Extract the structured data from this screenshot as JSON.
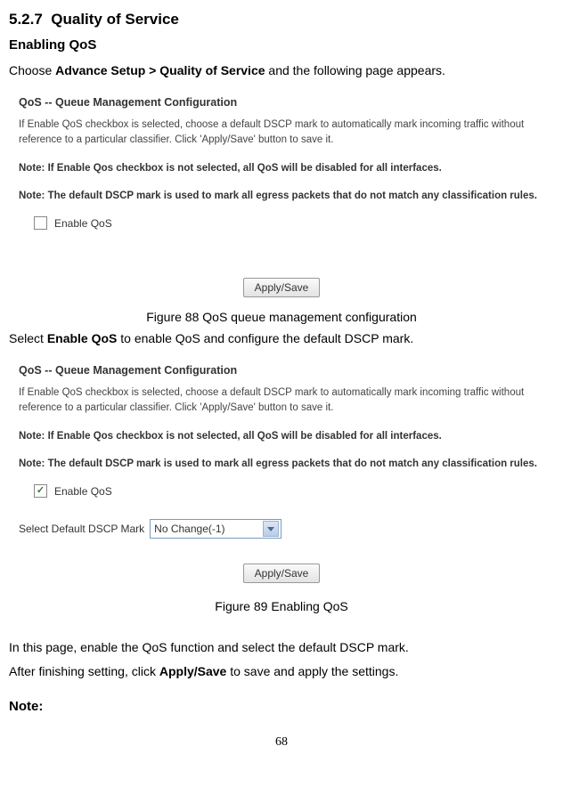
{
  "section": {
    "number": "5.2.7",
    "title": "Quality of Service"
  },
  "sub1": {
    "heading": "Enabling QoS",
    "intro_prefix": "Choose ",
    "intro_bold": "Advance Setup > Quality of Service",
    "intro_suffix": " and the following page appears."
  },
  "panel1": {
    "title": "QoS -- Queue Management Configuration",
    "desc": "If Enable QoS checkbox is selected, choose a default DSCP mark to automatically mark incoming traffic without reference to a particular classifier. Click 'Apply/Save' button to save it.",
    "note1": "Note: If Enable Qos checkbox is not selected, all QoS will be disabled for all interfaces.",
    "note2": "Note: The default DSCP mark is used to mark all egress packets that do not match any classification rules.",
    "enable_label": "Enable QoS",
    "apply_label": "Apply/Save"
  },
  "fig1": "Figure 88 QoS queue management configuration",
  "mid": {
    "prefix": "Select ",
    "bold": "Enable QoS",
    "suffix": " to enable QoS and configure the default DSCP mark."
  },
  "panel2": {
    "title": "QoS -- Queue Management Configuration",
    "desc": "If Enable QoS checkbox is selected, choose a default DSCP mark to automatically mark incoming traffic without reference to a particular classifier. Click 'Apply/Save' button to save it.",
    "note1": "Note: If Enable Qos checkbox is not selected, all QoS will be disabled for all interfaces.",
    "note2": "Note: The default DSCP mark is used to mark all egress packets that do not match any classification rules.",
    "enable_label": "Enable QoS",
    "select_label": "Select Default DSCP Mark",
    "select_value": "No Change(-1)",
    "apply_label": "Apply/Save"
  },
  "fig2": "Figure 89 Enabling QoS",
  "closing": {
    "line1": "In this page, enable the QoS function and select the default DSCP mark.",
    "line2_prefix": "After finishing setting, click ",
    "line2_bold": "Apply/Save",
    "line2_suffix": " to save and apply the settings."
  },
  "note_label": "Note:",
  "page_number": "68"
}
